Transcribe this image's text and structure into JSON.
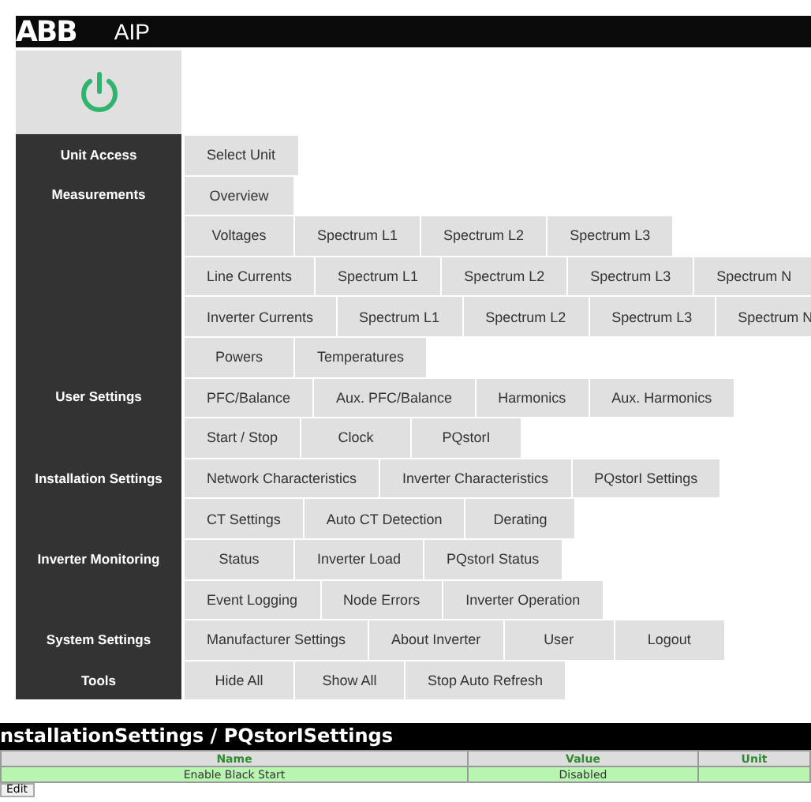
{
  "header": {
    "logo": "ABB",
    "title": "AIP"
  },
  "menu": [
    {
      "section": "Unit Access",
      "buttons": [
        "Select Unit"
      ]
    },
    {
      "section": "Measurements",
      "buttons": [
        "Overview"
      ]
    },
    {
      "buttons": [
        "Voltages",
        "Spectrum L1",
        "Spectrum L2",
        "Spectrum L3"
      ]
    },
    {
      "buttons": [
        "Line Currents",
        "Spectrum L1",
        "Spectrum L2",
        "Spectrum L3",
        "Spectrum N"
      ]
    },
    {
      "buttons": [
        "Inverter Currents",
        "Spectrum L1",
        "Spectrum L2",
        "Spectrum L3",
        "Spectrum N"
      ]
    },
    {
      "buttons": [
        "Powers",
        "Temperatures"
      ]
    },
    {
      "section": "User Settings",
      "buttons": [
        "PFC/Balance",
        "Aux. PFC/Balance",
        "Harmonics",
        "Aux. Harmonics"
      ]
    },
    {
      "buttons": [
        "Start / Stop",
        "Clock",
        "PQstorI"
      ]
    },
    {
      "section": "Installation Settings",
      "buttons": [
        "Network Characteristics",
        "Inverter Characteristics",
        "PQstorI Settings"
      ]
    },
    {
      "buttons": [
        "CT Settings",
        "Auto CT Detection",
        "Derating"
      ]
    },
    {
      "section": "Inverter Monitoring",
      "buttons": [
        "Status",
        "Inverter Load",
        "PQstorI Status"
      ]
    },
    {
      "buttons": [
        "Event Logging",
        "Node Errors",
        "Inverter Operation"
      ]
    },
    {
      "section": "System Settings",
      "buttons": [
        "Manufacturer Settings",
        "About Inverter",
        "User",
        "Logout"
      ]
    },
    {
      "section": "Tools",
      "buttons": [
        "Hide All",
        "Show All",
        "Stop Auto Refresh"
      ]
    }
  ],
  "panel": {
    "title": "nstallationSettings / PQstorISettings",
    "columns": [
      "Name",
      "Value",
      "Unit"
    ],
    "rows": [
      {
        "name": "Enable Black Start",
        "value": "Disabled"
      }
    ],
    "button": "Edit"
  }
}
